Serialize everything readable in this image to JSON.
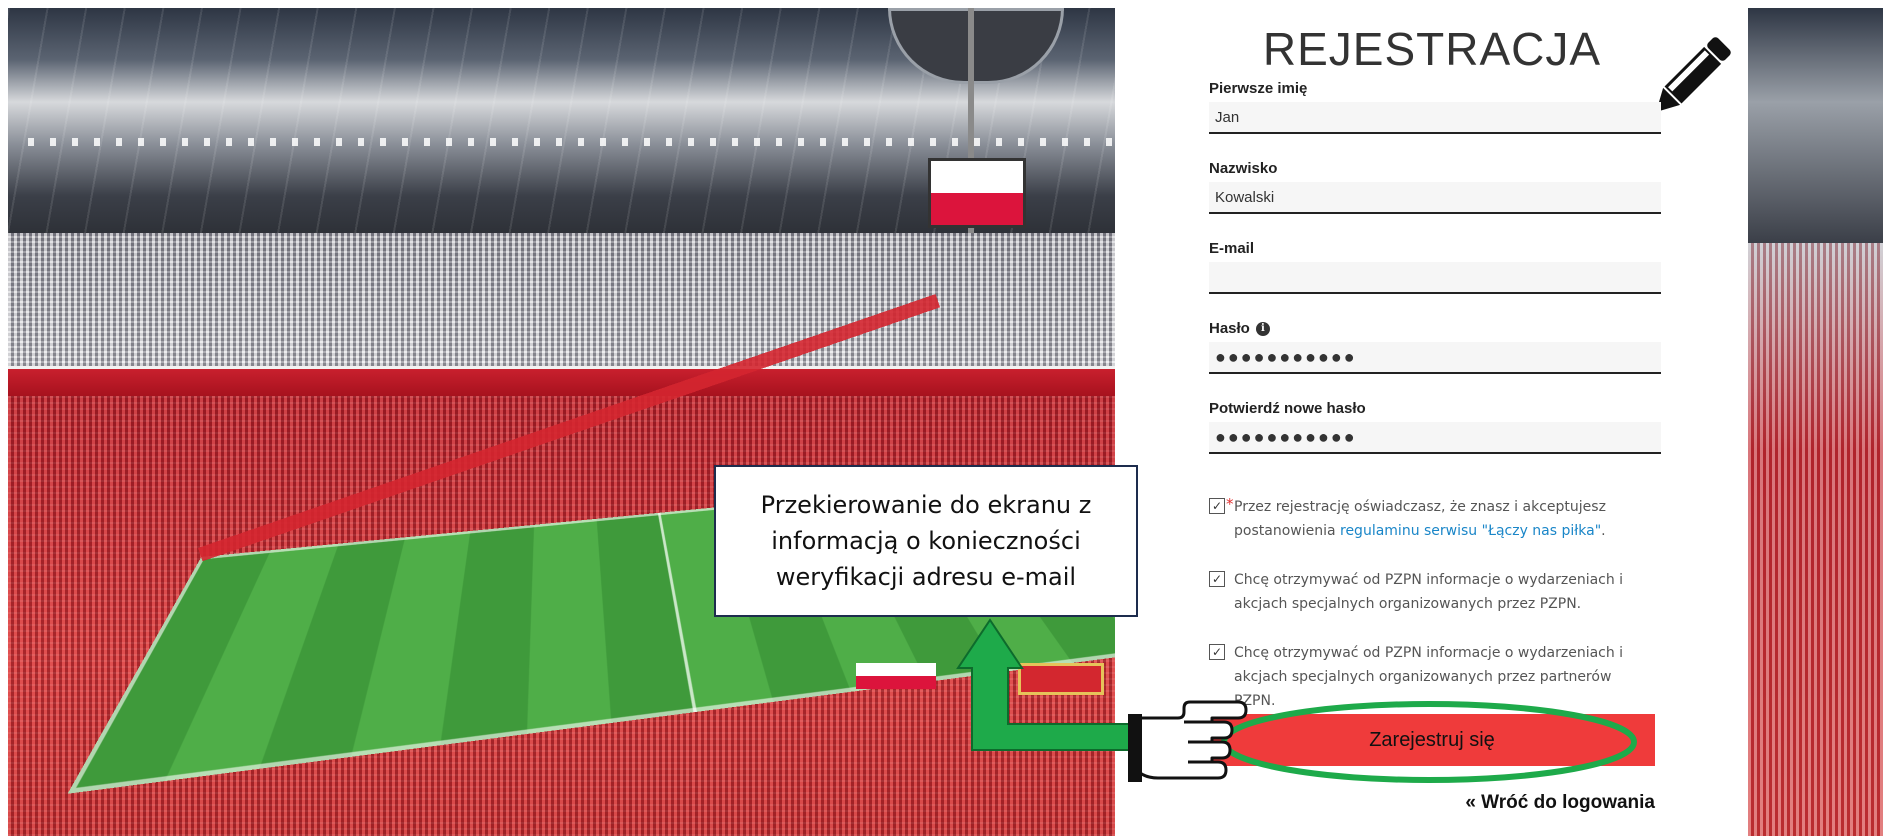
{
  "form": {
    "title": "REJESTRACJA",
    "fields": [
      {
        "label": "Pierwsze imię",
        "value": "Jan"
      },
      {
        "label": "Nazwisko",
        "value": "Kowalski"
      },
      {
        "label": "E-mail",
        "value": ""
      },
      {
        "label": "Hasło",
        "value": "●●●●●●●●●●●",
        "info_icon": "info-icon"
      },
      {
        "label": "Potwierdź nowe hasło",
        "value": "●●●●●●●●●●●"
      }
    ],
    "consents": [
      {
        "checked": true,
        "required": true,
        "text_before": "Przez rejestrację oświadczasz, że znasz i akceptujesz postanowienia ",
        "link_text": "regulaminu serwisu \"Łączy nas piłka\"",
        "text_after": "."
      },
      {
        "checked": true,
        "required": false,
        "text": "Chcę otrzymywać od PZPN informacje o wydarzeniach i akcjach specjalnych organizowanych przez PZPN."
      },
      {
        "checked": true,
        "required": false,
        "text": "Chcę otrzymywać od PZPN informacje o wydarzeniach i akcjach specjalnych organizowanych przez partnerów PZPN."
      }
    ],
    "submit_label": "Zarejestruj się",
    "back_link": "« Wróć do logowania"
  },
  "annotation": {
    "callout_text": "Przekierowanie do ekranu z informacją o konieczności weryfikacji adresu e-mail",
    "icons": [
      "pencil-icon",
      "pointing-hand-icon",
      "green-arrow",
      "green-ellipse"
    ]
  },
  "colors": {
    "button": "#ef3b3b",
    "link": "#1a86c8",
    "annotation_green": "#1eaa4a",
    "callout_border": "#1d2c4d"
  }
}
